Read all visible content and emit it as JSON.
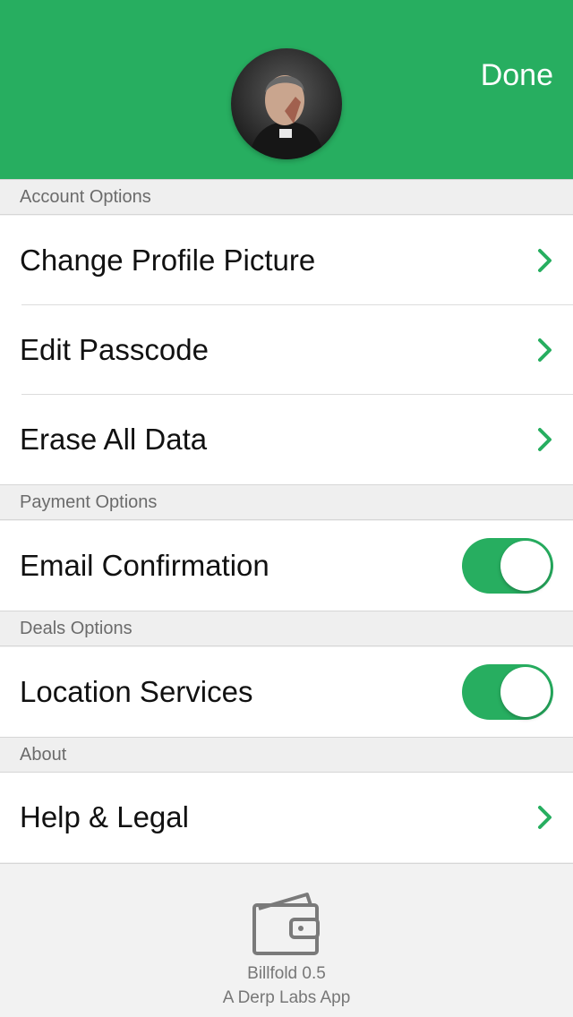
{
  "header": {
    "done_label": "Done",
    "background_color": "#27ae60"
  },
  "sections": {
    "account": {
      "title": "Account Options",
      "items": [
        {
          "label": "Change Profile Picture",
          "icon": "chevron-right-icon"
        },
        {
          "label": "Edit Passcode",
          "icon": "chevron-right-icon"
        },
        {
          "label": "Erase All Data",
          "icon": "chevron-right-icon"
        }
      ]
    },
    "payment": {
      "title": "Payment Options",
      "items": [
        {
          "label": "Email Confirmation",
          "toggle_on": true
        }
      ]
    },
    "deals": {
      "title": "Deals Options",
      "items": [
        {
          "label": "Location Services",
          "toggle_on": true
        }
      ]
    },
    "about": {
      "title": "About",
      "items": [
        {
          "label": "Help & Legal",
          "icon": "chevron-right-icon"
        }
      ]
    }
  },
  "footer": {
    "icon": "wallet-icon",
    "app_name": "Billfold 0.5",
    "app_byline": "A Derp Labs App"
  },
  "colors": {
    "accent": "#27ae60",
    "section_header_text": "#6b6b6b"
  }
}
